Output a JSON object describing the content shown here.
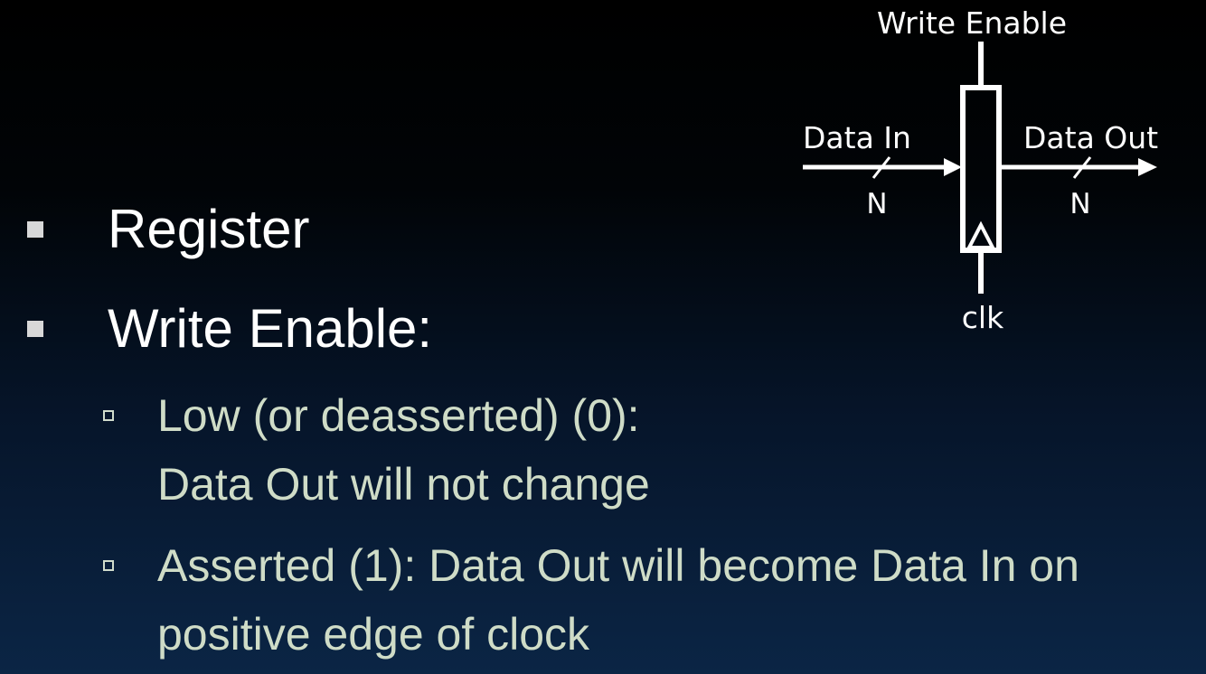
{
  "diagram": {
    "write_enable_label": "Write Enable",
    "data_in_label": "Data In",
    "data_out_label": "Data Out",
    "width_in_label": "N",
    "width_out_label": "N",
    "clk_label": "clk"
  },
  "bullets": [
    {
      "text": "Register",
      "level": 1
    },
    {
      "text": "Write Enable:",
      "level": 1,
      "sub_bullets": [
        {
          "line1": "Low (or deasserted) (0):",
          "line2": "Data Out will not change"
        },
        {
          "line1": "Asserted (1): Data Out will become Data In on",
          "line2": "positive edge of clock"
        }
      ]
    }
  ],
  "colors": {
    "background_top": "#000000",
    "background_bottom": "#0b2545",
    "level1_text": "#ffffff",
    "level2_text": "#cfdcc7",
    "bullet_marker": "#d8d8d8"
  }
}
